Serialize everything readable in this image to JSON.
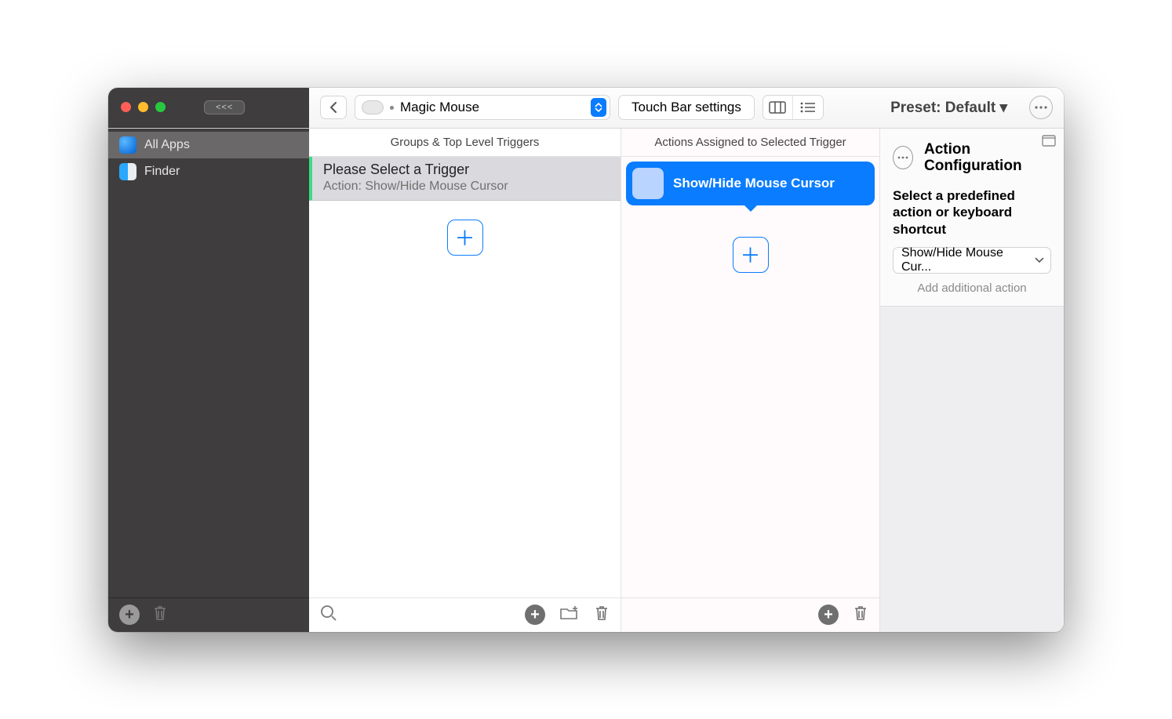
{
  "toolbar": {
    "back_pill": "<<<",
    "device": "Magic Mouse",
    "touchbar_btn": "Touch Bar settings",
    "preset_label": "Preset: Default ▾"
  },
  "sidebar": {
    "items": [
      {
        "label": "All Apps"
      },
      {
        "label": "Finder"
      }
    ]
  },
  "columns": {
    "triggers_header": "Groups & Top Level Triggers",
    "actions_header": "Actions Assigned to Selected Trigger",
    "trigger": {
      "title": "Please Select a Trigger",
      "subtitle": "Action: Show/Hide Mouse Cursor"
    },
    "action_chip": "Show/Hide Mouse Cursor"
  },
  "inspector": {
    "title": "Action Configuration",
    "subtitle": "Select a predefined action or keyboard shortcut",
    "select_value": "Show/Hide Mouse Cur...",
    "add_more": "Add additional action"
  }
}
